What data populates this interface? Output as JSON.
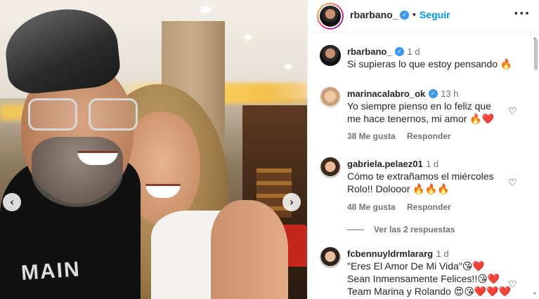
{
  "photo": {
    "shirt_text": "MAIN",
    "prev_icon": "‹",
    "next_icon": "›"
  },
  "header": {
    "username": "rbarbano_",
    "verified_icon": "✓",
    "dot": "•",
    "follow_label": "Seguir",
    "more_label": "···"
  },
  "caption": {
    "username": "rbarbano_",
    "time": "1 d",
    "text": "Si supieras lo que estoy pensando 🔥"
  },
  "comments": [
    {
      "username": "marinacalabro_ok",
      "time": "13 h",
      "verified": true,
      "line1": "Yo siempre pienso en lo feliz que",
      "line2": "me hace tenernos, mi amor 🔥❤️",
      "likes": "38 Me gusta",
      "reply": "Responder"
    },
    {
      "username": "gabriela.pelaez01",
      "time": "1 d",
      "verified": false,
      "line1": "Cómo te extrañamos el miércoles",
      "line2": "Rolo!! Dolooor 🔥🔥🔥",
      "likes": "48 Me gusta",
      "reply": "Responder"
    },
    {
      "username": "fcbennuyldrmlararg",
      "time": "1 d",
      "verified": false,
      "line1": "\"Eres El Amor De Mi Vida\"😘❤️",
      "line2": "Sean Inmensamente Felices!!😘❤️",
      "line3": "Team Marina y Rolando 😍😘❤️❤️❤️"
    }
  ],
  "view_replies": "Ver las 2 respuestas",
  "icons": {
    "heart": "♡"
  },
  "colors": {
    "link": "#0095f6",
    "verified": "#3897f0",
    "muted": "#737373"
  }
}
